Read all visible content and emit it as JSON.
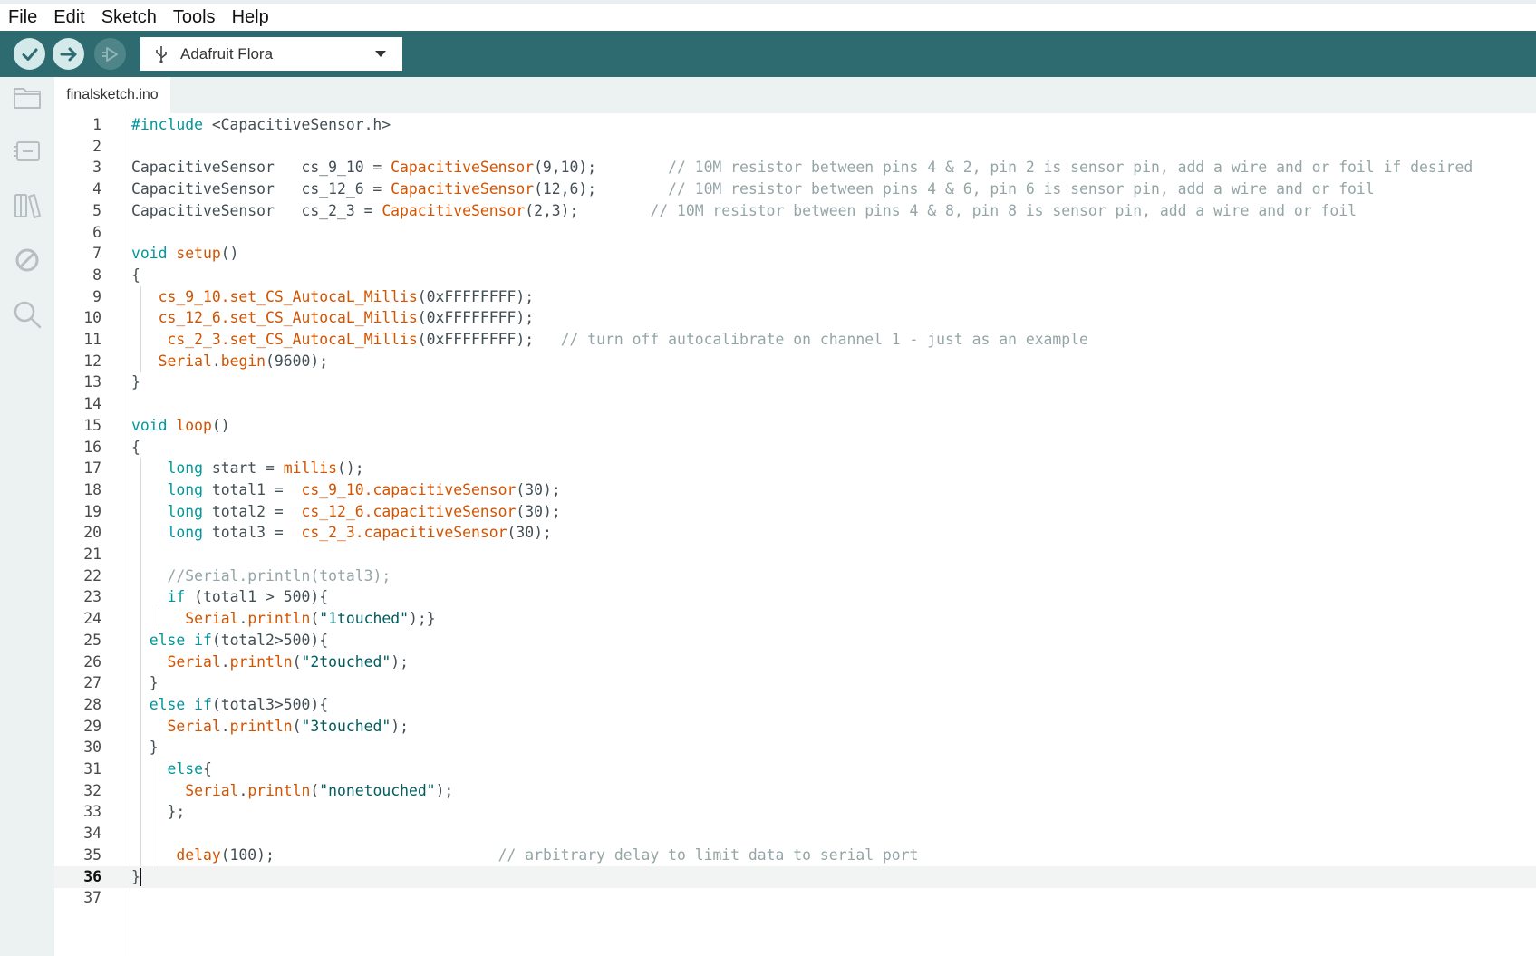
{
  "menu": [
    "File",
    "Edit",
    "Sketch",
    "Tools",
    "Help"
  ],
  "toolbar": {
    "board": "Adafruit Flora",
    "verify_icon": "check-icon",
    "upload_icon": "arrow-right-icon",
    "debug_icon": "debug-play-icon"
  },
  "sidebar": [
    "folder-icon",
    "board-manager-icon",
    "library-icon",
    "debug-disabled-icon",
    "search-icon"
  ],
  "tab": {
    "label": "finalsketch.ino"
  },
  "editor": {
    "current_line": 36,
    "lines": [
      {
        "n": "1",
        "segs": [
          [
            "kw",
            "#include "
          ],
          [
            "",
            "<CapacitiveSensor.h>"
          ]
        ]
      },
      {
        "n": "2",
        "segs": []
      },
      {
        "n": "3",
        "segs": [
          [
            "",
            "CapacitiveSensor   cs_9_10 = "
          ],
          [
            "fn",
            "CapacitiveSensor"
          ],
          [
            "",
            "(9,10);        "
          ],
          [
            "cm",
            "// 10M resistor between pins 4 & 2, pin 2 is sensor pin, add a wire and or foil if desired"
          ]
        ]
      },
      {
        "n": "4",
        "segs": [
          [
            "",
            "CapacitiveSensor   cs_12_6 = "
          ],
          [
            "fn",
            "CapacitiveSensor"
          ],
          [
            "",
            "(12,6);        "
          ],
          [
            "cm",
            "// 10M resistor between pins 4 & 6, pin 6 is sensor pin, add a wire and or foil"
          ]
        ]
      },
      {
        "n": "5",
        "segs": [
          [
            "",
            "CapacitiveSensor   cs_2_3 = "
          ],
          [
            "fn",
            "CapacitiveSensor"
          ],
          [
            "",
            "(2,3);        "
          ],
          [
            "cm",
            "// 10M resistor between pins 4 & 8, pin 8 is sensor pin, add a wire and or foil"
          ]
        ]
      },
      {
        "n": "6",
        "segs": []
      },
      {
        "n": "7",
        "segs": [
          [
            "kw",
            "void "
          ],
          [
            "fn",
            "setup"
          ],
          [
            "",
            "()"
          ]
        ]
      },
      {
        "n": "8",
        "segs": [
          [
            "",
            "{"
          ]
        ]
      },
      {
        "n": "9",
        "segs": [
          [
            "",
            "   "
          ],
          [
            "fn",
            "cs_9_10.set_CS_AutocaL_Millis"
          ],
          [
            "",
            "(0xFFFFFFFF);"
          ]
        ]
      },
      {
        "n": "10",
        "segs": [
          [
            "",
            "   "
          ],
          [
            "fn",
            "cs_12_6.set_CS_AutocaL_Millis"
          ],
          [
            "",
            "(0xFFFFFFFF);"
          ]
        ]
      },
      {
        "n": "11",
        "segs": [
          [
            "",
            "    "
          ],
          [
            "fn",
            "cs_2_3.set_CS_AutocaL_Millis"
          ],
          [
            "",
            "(0xFFFFFFFF);   "
          ],
          [
            "cm",
            "// turn off autocalibrate on channel 1 - just as an example"
          ]
        ]
      },
      {
        "n": "12",
        "segs": [
          [
            "",
            "   "
          ],
          [
            "fn",
            "Serial"
          ],
          [
            "",
            "."
          ],
          [
            "fn",
            "begin"
          ],
          [
            "",
            "(9600);"
          ]
        ]
      },
      {
        "n": "13",
        "segs": [
          [
            "",
            "}"
          ]
        ]
      },
      {
        "n": "14",
        "segs": []
      },
      {
        "n": "15",
        "segs": [
          [
            "kw",
            "void "
          ],
          [
            "fn",
            "loop"
          ],
          [
            "",
            "()"
          ]
        ]
      },
      {
        "n": "16",
        "segs": [
          [
            "",
            "{"
          ]
        ]
      },
      {
        "n": "17",
        "segs": [
          [
            "",
            "    "
          ],
          [
            "kw",
            "long "
          ],
          [
            "",
            "start = "
          ],
          [
            "fn",
            "millis"
          ],
          [
            "",
            "();"
          ]
        ]
      },
      {
        "n": "18",
        "segs": [
          [
            "",
            "    "
          ],
          [
            "kw",
            "long "
          ],
          [
            "",
            "total1 =  "
          ],
          [
            "fn",
            "cs_9_10.capacitiveSensor"
          ],
          [
            "",
            "(30);"
          ]
        ]
      },
      {
        "n": "19",
        "segs": [
          [
            "",
            "    "
          ],
          [
            "kw",
            "long "
          ],
          [
            "",
            "total2 =  "
          ],
          [
            "fn",
            "cs_12_6.capacitiveSensor"
          ],
          [
            "",
            "(30);"
          ]
        ]
      },
      {
        "n": "20",
        "segs": [
          [
            "",
            "    "
          ],
          [
            "kw",
            "long "
          ],
          [
            "",
            "total3 =  "
          ],
          [
            "fn",
            "cs_2_3.capacitiveSensor"
          ],
          [
            "",
            "(30);"
          ]
        ]
      },
      {
        "n": "21",
        "segs": []
      },
      {
        "n": "22",
        "segs": [
          [
            "",
            "    "
          ],
          [
            "cm",
            "//Serial.println(total3);"
          ]
        ]
      },
      {
        "n": "23",
        "segs": [
          [
            "",
            "    "
          ],
          [
            "kw",
            "if "
          ],
          [
            "",
            "(total1 > 500){"
          ]
        ]
      },
      {
        "n": "24",
        "segs": [
          [
            "",
            "      "
          ],
          [
            "fn",
            "Serial"
          ],
          [
            "",
            "."
          ],
          [
            "fn",
            "println"
          ],
          [
            "",
            "("
          ],
          [
            "st",
            "\"1touched\""
          ],
          [
            "",
            ");}"
          ]
        ]
      },
      {
        "n": "25",
        "segs": [
          [
            "",
            "  "
          ],
          [
            "kw",
            "else if"
          ],
          [
            "",
            "(total2>500){"
          ]
        ]
      },
      {
        "n": "26",
        "segs": [
          [
            "",
            "    "
          ],
          [
            "fn",
            "Serial"
          ],
          [
            "",
            "."
          ],
          [
            "fn",
            "println"
          ],
          [
            "",
            "("
          ],
          [
            "st",
            "\"2touched\""
          ],
          [
            "",
            ");"
          ]
        ]
      },
      {
        "n": "27",
        "segs": [
          [
            "",
            "  }"
          ]
        ]
      },
      {
        "n": "28",
        "segs": [
          [
            "",
            "  "
          ],
          [
            "kw",
            "else if"
          ],
          [
            "",
            "(total3>500){"
          ]
        ]
      },
      {
        "n": "29",
        "segs": [
          [
            "",
            "    "
          ],
          [
            "fn",
            "Serial"
          ],
          [
            "",
            "."
          ],
          [
            "fn",
            "println"
          ],
          [
            "",
            "("
          ],
          [
            "st",
            "\"3touched\""
          ],
          [
            "",
            ");"
          ]
        ]
      },
      {
        "n": "30",
        "segs": [
          [
            "",
            "  }"
          ]
        ]
      },
      {
        "n": "31",
        "segs": [
          [
            "",
            "    "
          ],
          [
            "kw",
            "else"
          ],
          [
            "",
            "{"
          ]
        ]
      },
      {
        "n": "32",
        "segs": [
          [
            "",
            "      "
          ],
          [
            "fn",
            "Serial"
          ],
          [
            "",
            "."
          ],
          [
            "fn",
            "println"
          ],
          [
            "",
            "("
          ],
          [
            "st",
            "\"nonetouched\""
          ],
          [
            "",
            ");"
          ]
        ]
      },
      {
        "n": "33",
        "segs": [
          [
            "",
            "    };"
          ]
        ]
      },
      {
        "n": "34",
        "segs": []
      },
      {
        "n": "35",
        "segs": [
          [
            "",
            "     "
          ],
          [
            "fn",
            "delay"
          ],
          [
            "",
            "(100);                         "
          ],
          [
            "cm",
            "// arbitrary delay to limit data to serial port"
          ]
        ]
      },
      {
        "n": "36",
        "segs": [
          [
            "",
            "}"
          ]
        ]
      },
      {
        "n": "37",
        "segs": []
      }
    ]
  }
}
